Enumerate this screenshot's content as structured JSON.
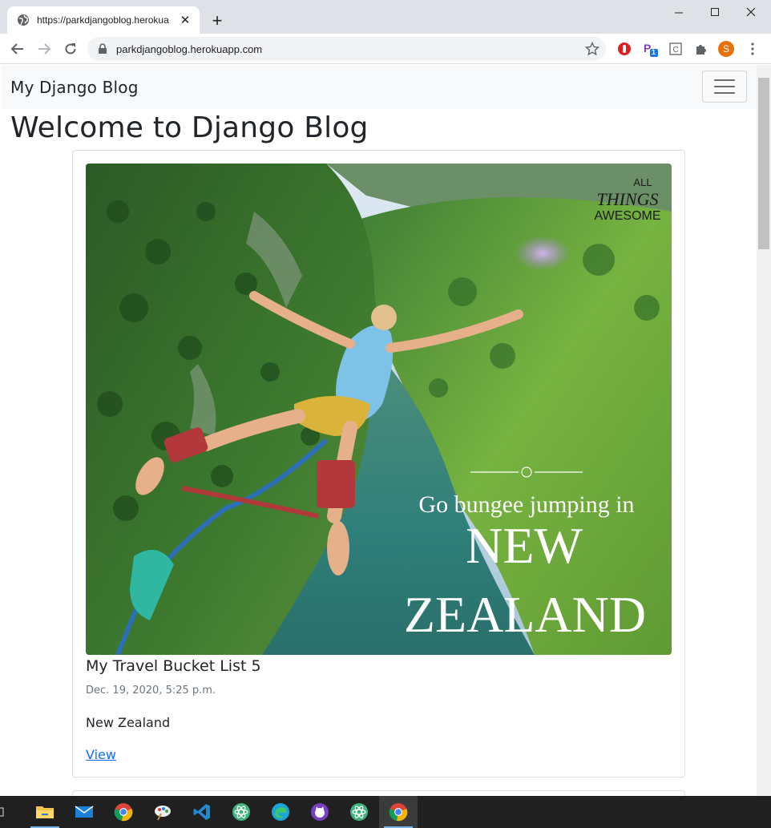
{
  "browser": {
    "tab_title": "https://parkdjangoblog.herokua",
    "url": "parkdjangoblog.herokuapp.com",
    "profile_initial": "S",
    "extension_badge": "1"
  },
  "navbar": {
    "brand": "My Django Blog"
  },
  "page": {
    "heading": "Welcome to Django Blog"
  },
  "posts": [
    {
      "image_text": {
        "logo_line1": "ALL",
        "logo_line2": "THINGS",
        "logo_line3": "AWESOME",
        "caption_line1": "Go bungee jumping in",
        "caption_line2": "NEW",
        "caption_line3": "ZEALAND"
      },
      "title": "My Travel Bucket List 5",
      "date": "Dec. 19, 2020, 5:25 p.m.",
      "body": "New Zealand",
      "link_label": "View"
    }
  ],
  "colors": {
    "navbar_bg": "#f8f9fa",
    "link": "#0d6efd",
    "muted": "#6c757d",
    "taskbar_bg": "#202020"
  }
}
